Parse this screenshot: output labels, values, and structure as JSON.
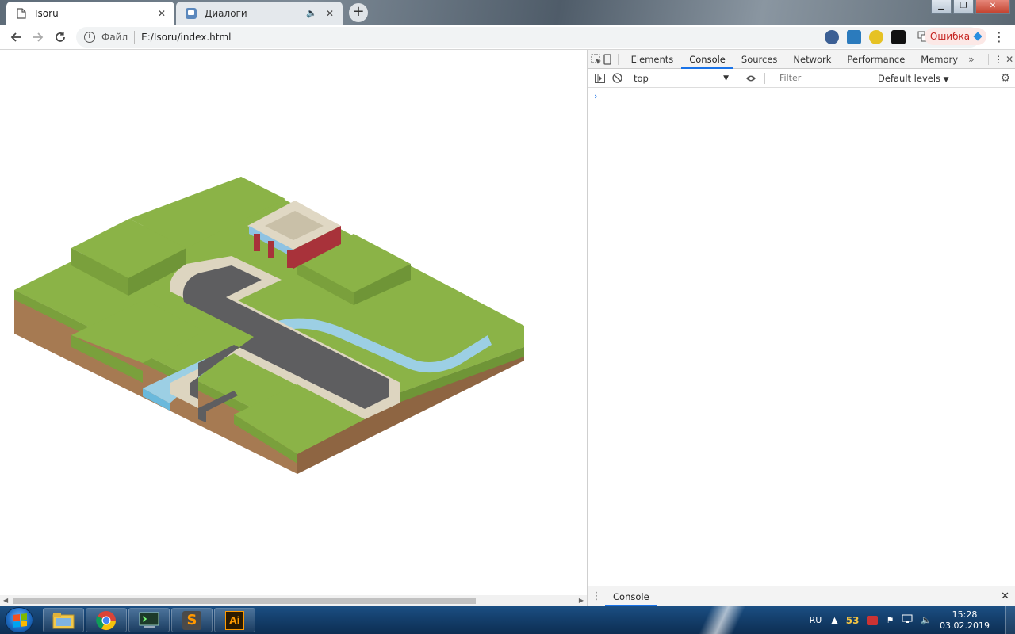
{
  "browser": {
    "tabs": [
      {
        "title": "Isoru",
        "active": true
      },
      {
        "title": "Диалоги",
        "active": false
      }
    ],
    "address": {
      "scheme_label": "Файл",
      "url": "E:/Isoru/index.html"
    },
    "error_button": "Ошибка"
  },
  "devtools": {
    "tabs": [
      "Elements",
      "Console",
      "Sources",
      "Network",
      "Performance",
      "Memory"
    ],
    "selected_tab": "Console",
    "context": "top",
    "filter_placeholder": "Filter",
    "levels": "Default levels",
    "prompt": "›",
    "drawer_tab": "Console"
  },
  "scene": {
    "colors": {
      "grass_top": "#8bb347",
      "grass_side": "#6f9537",
      "dirt_left": "#a67a52",
      "dirt_right": "#8e6542",
      "road": "#5e5e60",
      "curb": "#ddd5c0",
      "water": "#9ccfe4",
      "water_fall": "#6ab9dc",
      "building_red": "#a8323a",
      "building_roof": "#e0d8c4",
      "awning": "#8fc3e3"
    }
  },
  "taskbar": {
    "apps": [
      {
        "name": "file-explorer"
      },
      {
        "name": "chrome"
      },
      {
        "name": "terminal"
      },
      {
        "name": "sublime-text",
        "label": "S"
      },
      {
        "name": "illustrator",
        "label": "Ai"
      }
    ],
    "language": "RU",
    "tray_badge": "53",
    "time": "15:28",
    "date": "03.02.2019"
  }
}
